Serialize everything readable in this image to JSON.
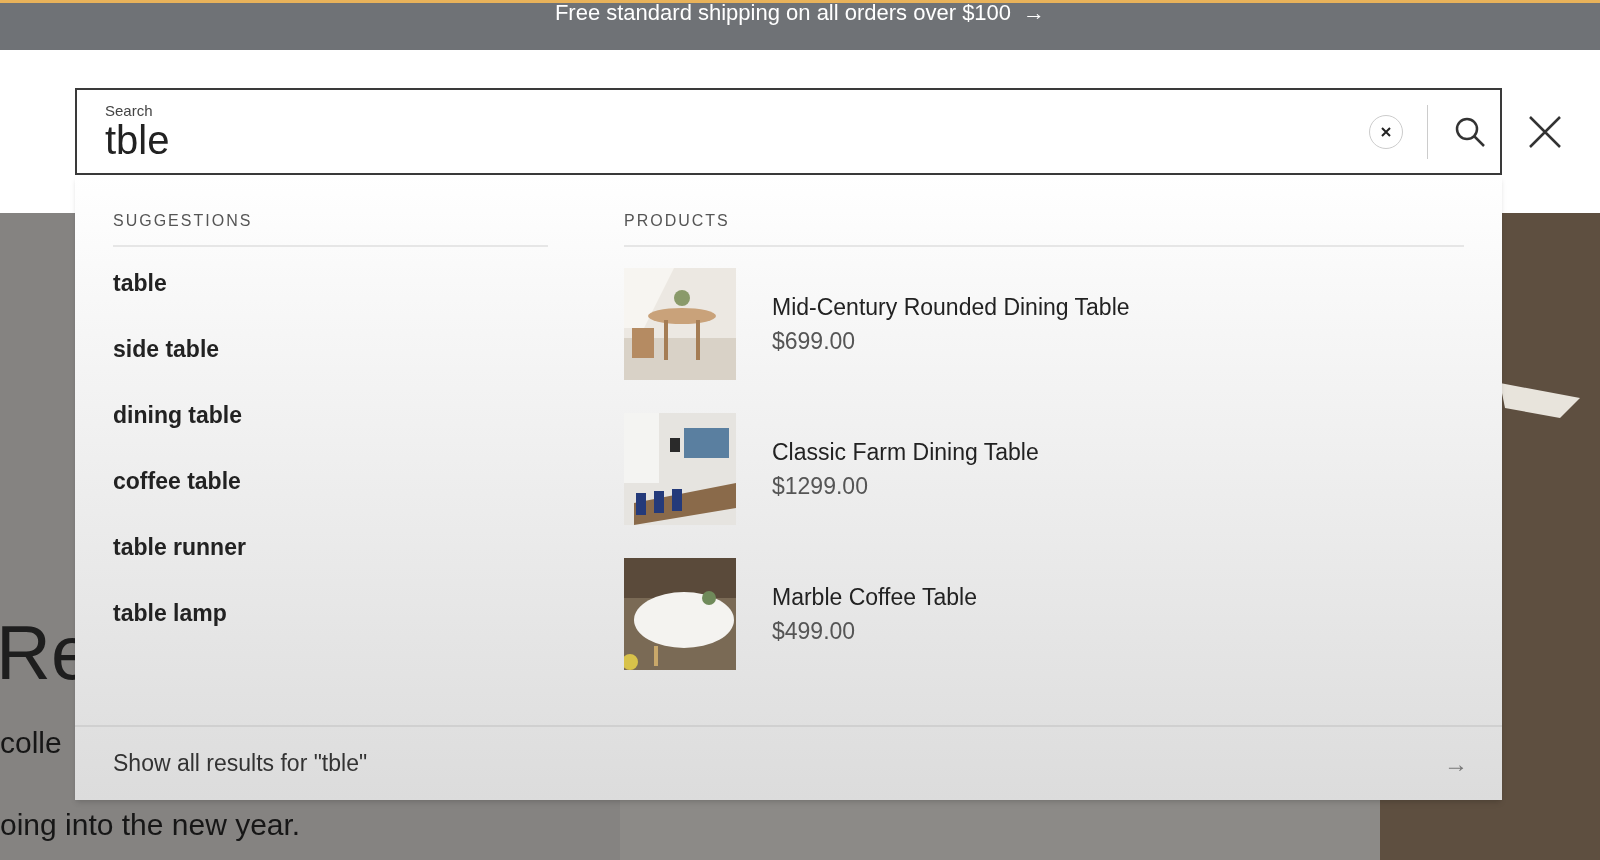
{
  "banner": {
    "text": "Free standard shipping on all orders over $100",
    "arrow": "→"
  },
  "search": {
    "label": "Search",
    "value": "tble"
  },
  "hero": {
    "heading": "Re",
    "lines": [
      "colle",
      "oing into the new year."
    ]
  },
  "suggestions": {
    "heading": "SUGGESTIONS",
    "items": [
      "table",
      "side table",
      "dining table",
      "coffee table",
      "table runner",
      "table lamp"
    ]
  },
  "products": {
    "heading": "PRODUCTS",
    "items": [
      {
        "name": "Mid-Century Rounded Dining Table",
        "price": "$699.00"
      },
      {
        "name": "Classic Farm Dining Table",
        "price": "$1299.00"
      },
      {
        "name": "Marble Coffee Table",
        "price": "$499.00"
      }
    ]
  },
  "footer": {
    "text": "Show all results for \"tble\"",
    "arrow": "→"
  }
}
